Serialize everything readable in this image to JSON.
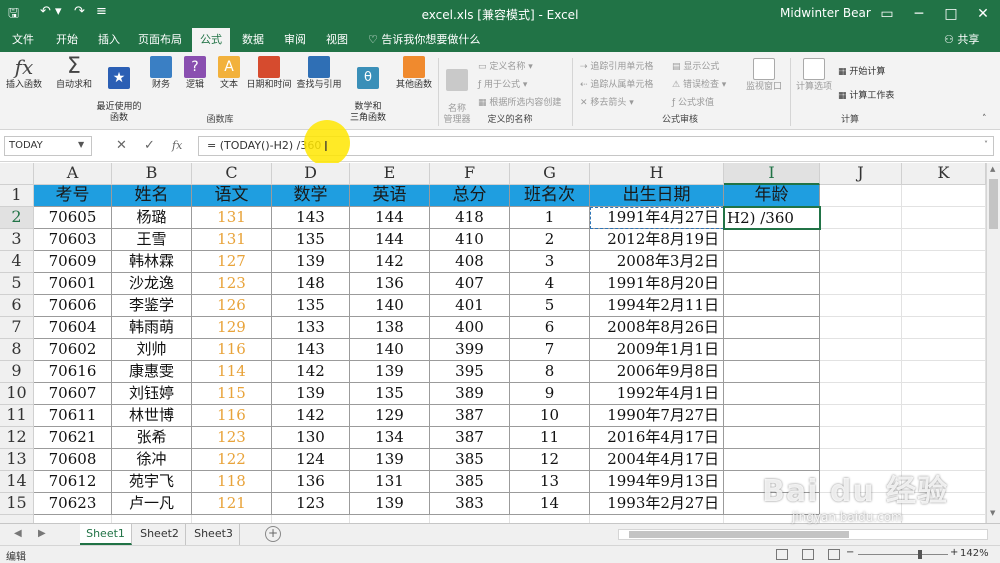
{
  "window": {
    "title": "excel.xls  [兼容模式]  -  Excel",
    "user": "Midwinter Bear",
    "qa_save": "🖫",
    "qa_undo": "↶ ▾",
    "qa_redo": "↷",
    "qa_custom": "≡",
    "btn_options": "▭",
    "btn_min": "─",
    "btn_max": "□",
    "btn_close": "✕"
  },
  "tabs": [
    "文件",
    "开始",
    "插入",
    "页面布局",
    "公式",
    "数据",
    "审阅",
    "视图"
  ],
  "active_tab": "公式",
  "tell_me": "告诉我你想要做什么",
  "share": "共享",
  "ribbon": {
    "function_library": {
      "label": "函数库",
      "buttons": [
        {
          "label": "插入函数",
          "icon": "fx-icon"
        },
        {
          "label": "自动求和",
          "icon": "sigma-icon"
        },
        {
          "label": "最近使用的\n函数",
          "icon": "star-icon"
        },
        {
          "label": "财务",
          "icon": "finance-icon"
        },
        {
          "label": "逻辑",
          "icon": "logic-icon"
        },
        {
          "label": "文本",
          "icon": "text-icon"
        },
        {
          "label": "日期和时间",
          "icon": "calendar-icon"
        },
        {
          "label": "查找与引用",
          "icon": "lookup-icon"
        },
        {
          "label": "数学和\n三角函数",
          "icon": "math-icon"
        },
        {
          "label": "其他函数",
          "icon": "more-functions-icon"
        }
      ]
    },
    "defined_names": {
      "label": "定义的名称",
      "name_manager": "名称\n管理器",
      "items": [
        "定义名称 ▾",
        "用于公式 ▾",
        "根据所选内容创建"
      ]
    },
    "formula_auditing": {
      "label": "公式审核",
      "items": [
        "追踪引用单元格",
        "追踪从属单元格",
        "移去箭头 ▾",
        "显示公式",
        "错误检查 ▾",
        "公式求值"
      ],
      "watch_window": "监视窗口"
    },
    "calculation": {
      "label": "计算",
      "options": "计算选项",
      "items": [
        "开始计算",
        "计算工作表"
      ]
    }
  },
  "formula_bar": {
    "name_box": "TODAY",
    "cancel": "✕",
    "enter": "✓",
    "fx": "fx",
    "formula": "= (TODAY()-H2) /360",
    "caret": "I"
  },
  "grid": {
    "columns": [
      "A",
      "B",
      "C",
      "D",
      "E",
      "F",
      "G",
      "H",
      "I",
      "J",
      "K"
    ],
    "selected_column": "I",
    "selected_row": 2,
    "row_numbers": [
      1,
      2,
      3,
      4,
      5,
      6,
      7,
      8,
      9,
      10,
      11,
      12,
      13,
      14,
      15
    ],
    "headers": [
      "考号",
      "姓名",
      "语文",
      "数学",
      "英语",
      "总分",
      "班名次",
      "出生日期",
      "年龄"
    ],
    "rows": [
      [
        "70605",
        "杨璐",
        "131",
        "143",
        "144",
        "418",
        "1",
        "1991年4月27日"
      ],
      [
        "70603",
        "王雪",
        "131",
        "135",
        "144",
        "410",
        "2",
        "2012年8月19日"
      ],
      [
        "70609",
        "韩林霖",
        "127",
        "139",
        "142",
        "408",
        "3",
        "2008年3月2日"
      ],
      [
        "70601",
        "沙龙逸",
        "123",
        "148",
        "136",
        "407",
        "4",
        "1991年8月20日"
      ],
      [
        "70606",
        "李鉴学",
        "126",
        "135",
        "140",
        "401",
        "5",
        "1994年2月11日"
      ],
      [
        "70604",
        "韩雨萌",
        "129",
        "133",
        "138",
        "400",
        "6",
        "2008年8月26日"
      ],
      [
        "70602",
        "刘帅",
        "116",
        "143",
        "140",
        "399",
        "7",
        "2009年1月1日"
      ],
      [
        "70616",
        "康惠雯",
        "114",
        "142",
        "139",
        "395",
        "8",
        "2006年9月8日"
      ],
      [
        "70607",
        "刘钰婷",
        "115",
        "139",
        "135",
        "389",
        "9",
        "1992年4月1日"
      ],
      [
        "70611",
        "林世博",
        "116",
        "142",
        "129",
        "387",
        "10",
        "1990年7月27日"
      ],
      [
        "70621",
        "张希",
        "123",
        "130",
        "134",
        "387",
        "11",
        "2016年4月17日"
      ],
      [
        "70608",
        "徐冲",
        "122",
        "124",
        "139",
        "385",
        "12",
        "2004年4月17日"
      ],
      [
        "70612",
        "苑宇飞",
        "118",
        "136",
        "131",
        "385",
        "13",
        "1994年9月13日"
      ],
      [
        "70623",
        "卢一凡",
        "121",
        "123",
        "139",
        "383",
        "14",
        "1993年2月27日"
      ]
    ],
    "active_cell_text": "H2) /360",
    "accent_header_color": "#1f9ee0",
    "orange_text_color": "#e8a33a",
    "excel_green": "#217346"
  },
  "sheets": [
    "Sheet1",
    "Sheet2",
    "Sheet3"
  ],
  "active_sheet": "Sheet1",
  "status": {
    "mode": "编辑",
    "zoom": "142%"
  },
  "watermark": {
    "main": "Bai du 经验",
    "sub": "jingyan.baidu.com"
  }
}
